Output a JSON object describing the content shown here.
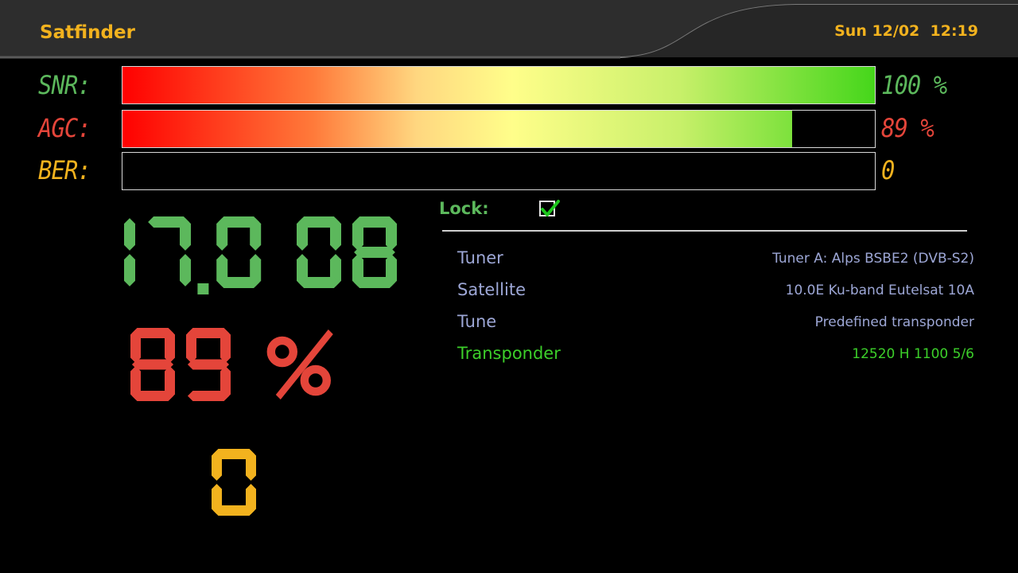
{
  "header": {
    "title": "Satfinder",
    "datetime": "Sun 12/02  12:19"
  },
  "meters": [
    {
      "label": "SNR:",
      "value": "100 %",
      "level_percent": 100,
      "color": "#5cb85c"
    },
    {
      "label": "AGC:",
      "value": "89 %",
      "level_percent": 89,
      "color": "#e4453a"
    },
    {
      "label": "BER:",
      "value": "0",
      "level_percent": 0,
      "color": "#f2b21e"
    }
  ],
  "big_readouts": {
    "snr_db": "17.0 DB",
    "agc_percent": "89 %",
    "ber": "0"
  },
  "lock": {
    "label": "Lock:",
    "checked": true
  },
  "info": [
    {
      "key": "Tuner",
      "value": "Tuner A: Alps BSBE2 (DVB-S2)"
    },
    {
      "key": "Satellite",
      "value": "10.0E Ku-band Eutelsat 10A"
    },
    {
      "key": "Tune",
      "value": "Predefined transponder"
    },
    {
      "key": "Transponder",
      "value": "12520 H 1100 5/6"
    }
  ],
  "colors": {
    "accent": "#f2b21e",
    "info_text": "#9da7d6",
    "info_selected": "#3ccf2a",
    "snr_green": "#5cb85c",
    "agc_red": "#e4453a",
    "ber_yellow": "#f2b21e"
  }
}
